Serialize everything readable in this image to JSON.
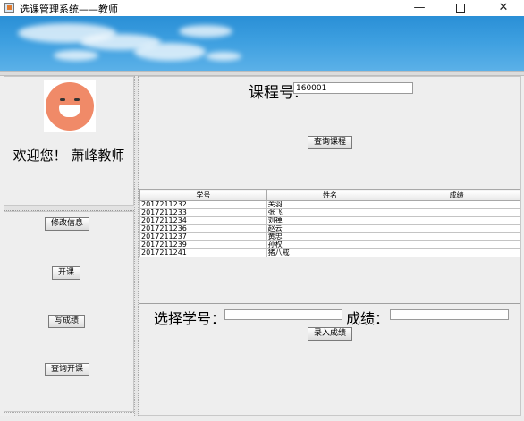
{
  "window": {
    "title": "选课管理系统——教师",
    "minimize_icon": "minimize-icon",
    "maximize_icon": "maximize-icon",
    "close_icon": "close-icon",
    "minimize_glyph": "—",
    "close_glyph": "✕"
  },
  "sidebar": {
    "welcome": "欢迎您！ 萧峰教师",
    "buttons": [
      "修改信息",
      "开课",
      "写成绩",
      "查询开课"
    ]
  },
  "main": {
    "course_label": "课程号:",
    "course_value": "160001",
    "query_button": "查询课程",
    "table": {
      "columns": [
        "学号",
        "姓名",
        "成绩"
      ],
      "rows": [
        [
          "2017211232",
          "关羽",
          ""
        ],
        [
          "2017211233",
          "张飞",
          ""
        ],
        [
          "2017211234",
          "刘禅",
          ""
        ],
        [
          "2017211236",
          "赵云",
          ""
        ],
        [
          "2017211237",
          "黄忠",
          ""
        ],
        [
          "2017211239",
          "孙权",
          ""
        ],
        [
          "2017211241",
          "猪八戒",
          ""
        ]
      ]
    },
    "select_id_label": "选择学号：",
    "score_label": "成绩：",
    "submit_button": "录入成绩"
  },
  "colors": {
    "banner_sky": "#3d9fe0",
    "avatar_bg": "#f08a68"
  }
}
